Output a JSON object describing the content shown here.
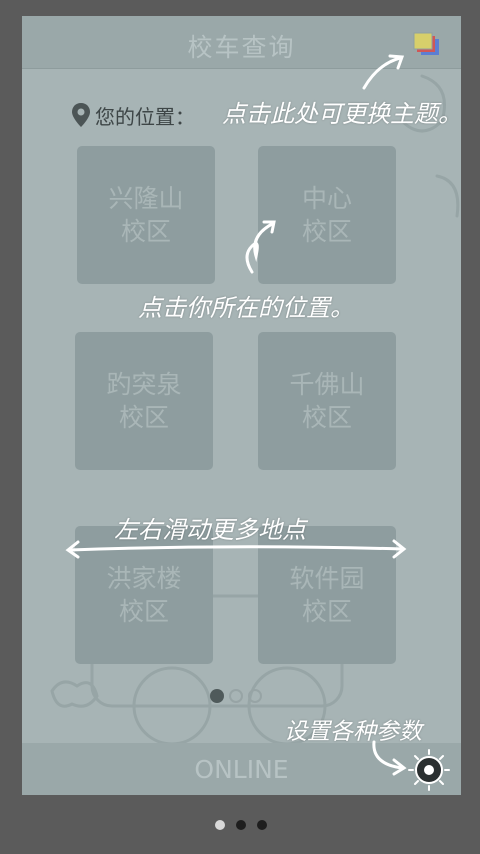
{
  "app": {
    "title": "校车查询",
    "location_label": "您的位置："
  },
  "campuses": [
    {
      "line1": "兴隆山",
      "line2": "校区"
    },
    {
      "line1": "中心",
      "line2": "校区"
    },
    {
      "line1": "趵突泉",
      "line2": "校区"
    },
    {
      "line1": "千佛山",
      "line2": "校区"
    },
    {
      "line1": "洪家楼",
      "line2": "校区"
    },
    {
      "line1": "软件园",
      "line2": "校区"
    }
  ],
  "bottom": {
    "online_label": "ONLINE"
  },
  "hints": {
    "theme_hint": "点击此处可更换主题。",
    "location_hint": "点击你所在的位置。",
    "swipe_hint": "左右滑动更多地点",
    "settings_hint": "设置各种参数"
  },
  "pager": {
    "inner_pages": 3,
    "inner_active": 0,
    "outer_pages": 3,
    "outer_active": 0
  },
  "icons": {
    "theme": "layers-icon",
    "location": "map-pin-icon",
    "settings": "gear-icon"
  },
  "colors": {
    "tile": "#8e9d9f",
    "tile_text": "#a9b6b7",
    "hint_text": "#ffffff",
    "background": "#5b5b5b"
  }
}
